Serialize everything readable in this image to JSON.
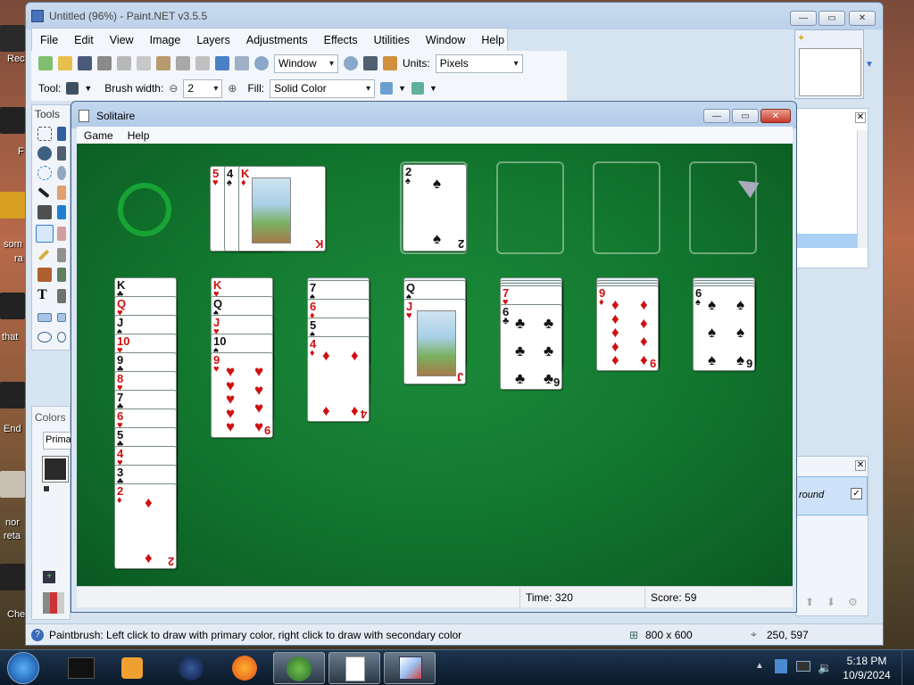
{
  "desktop": {
    "labels": [
      "Rec",
      "F",
      "som",
      "ra",
      "that",
      "End",
      "nor",
      "reta",
      "Che"
    ]
  },
  "paintnet": {
    "title": "Untitled (96%) - Paint.NET v3.5.5",
    "menu": [
      "File",
      "Edit",
      "View",
      "Image",
      "Layers",
      "Adjustments",
      "Effects",
      "Utilities",
      "Window",
      "Help"
    ],
    "zoom_select": "Window",
    "units_label": "Units:",
    "units_value": "Pixels",
    "tool_label": "Tool:",
    "brush_width_label": "Brush width:",
    "brush_width_value": "2",
    "fill_label": "Fill:",
    "fill_value": "Solid Color",
    "tools_panel_title": "Tools",
    "colors_panel_title": "Colors",
    "colors_mode": "Primar",
    "layer_name_fragment": "round",
    "status_hint": "Paintbrush: Left click to draw with primary color, right click to draw with secondary color",
    "image_size": "800 x 600",
    "cursor_pos": "250, 597"
  },
  "solitaire": {
    "title": "Solitaire",
    "menu": [
      "Game",
      "Help"
    ],
    "time_label": "Time:",
    "time_value": "320",
    "score_label": "Score:",
    "score_value": "59",
    "waste": [
      {
        "rank": "5",
        "suit": "♥",
        "color": "red"
      },
      {
        "rank": "4",
        "suit": "♠",
        "color": "blk"
      },
      {
        "rank": "K",
        "suit": "♦",
        "color": "red"
      }
    ],
    "foundation": [
      {
        "rank": "2",
        "suit": "♠",
        "color": "blk"
      }
    ],
    "tableau": [
      {
        "cards": [
          {
            "rank": "K",
            "suit": "♣",
            "color": "blk"
          },
          {
            "rank": "Q",
            "suit": "♥",
            "color": "red"
          },
          {
            "rank": "J",
            "suit": "♠",
            "color": "blk"
          },
          {
            "rank": "10",
            "suit": "♥",
            "color": "red"
          },
          {
            "rank": "9",
            "suit": "♣",
            "color": "blk"
          },
          {
            "rank": "8",
            "suit": "♥",
            "color": "red"
          },
          {
            "rank": "7",
            "suit": "♣",
            "color": "blk"
          },
          {
            "rank": "6",
            "suit": "♥",
            "color": "red"
          },
          {
            "rank": "5",
            "suit": "♣",
            "color": "blk"
          },
          {
            "rank": "4",
            "suit": "♥",
            "color": "red"
          },
          {
            "rank": "3",
            "suit": "♣",
            "color": "blk"
          },
          {
            "rank": "2",
            "suit": "♦",
            "color": "red"
          }
        ]
      },
      {
        "cards": [
          {
            "rank": "K",
            "suit": "♥",
            "color": "red"
          },
          {
            "rank": "Q",
            "suit": "♠",
            "color": "blk"
          },
          {
            "rank": "J",
            "suit": "♥",
            "color": "red"
          },
          {
            "rank": "10",
            "suit": "♠",
            "color": "blk"
          },
          {
            "rank": "9",
            "suit": "♥",
            "color": "red"
          }
        ]
      },
      {
        "cards": [
          {
            "rank": "7",
            "suit": "♠",
            "color": "blk"
          },
          {
            "rank": "6",
            "suit": "♦",
            "color": "red"
          },
          {
            "rank": "5",
            "suit": "♠",
            "color": "blk"
          },
          {
            "rank": "4",
            "suit": "♦",
            "color": "red"
          }
        ]
      },
      {
        "cards": [
          {
            "rank": "Q",
            "suit": "♠",
            "color": "blk"
          },
          {
            "rank": "J",
            "suit": "♥",
            "color": "red"
          }
        ]
      },
      {
        "cards": [
          {
            "rank": "7",
            "suit": "♥",
            "color": "red"
          },
          {
            "rank": "6",
            "suit": "♣",
            "color": "blk"
          }
        ]
      },
      {
        "cards": [
          {
            "rank": "9",
            "suit": "♦",
            "color": "red"
          }
        ]
      },
      {
        "cards": [
          {
            "rank": "6",
            "suit": "♠",
            "color": "blk"
          }
        ]
      }
    ]
  },
  "taskbar": {
    "time": "5:18 PM",
    "date": "10/9/2024"
  }
}
